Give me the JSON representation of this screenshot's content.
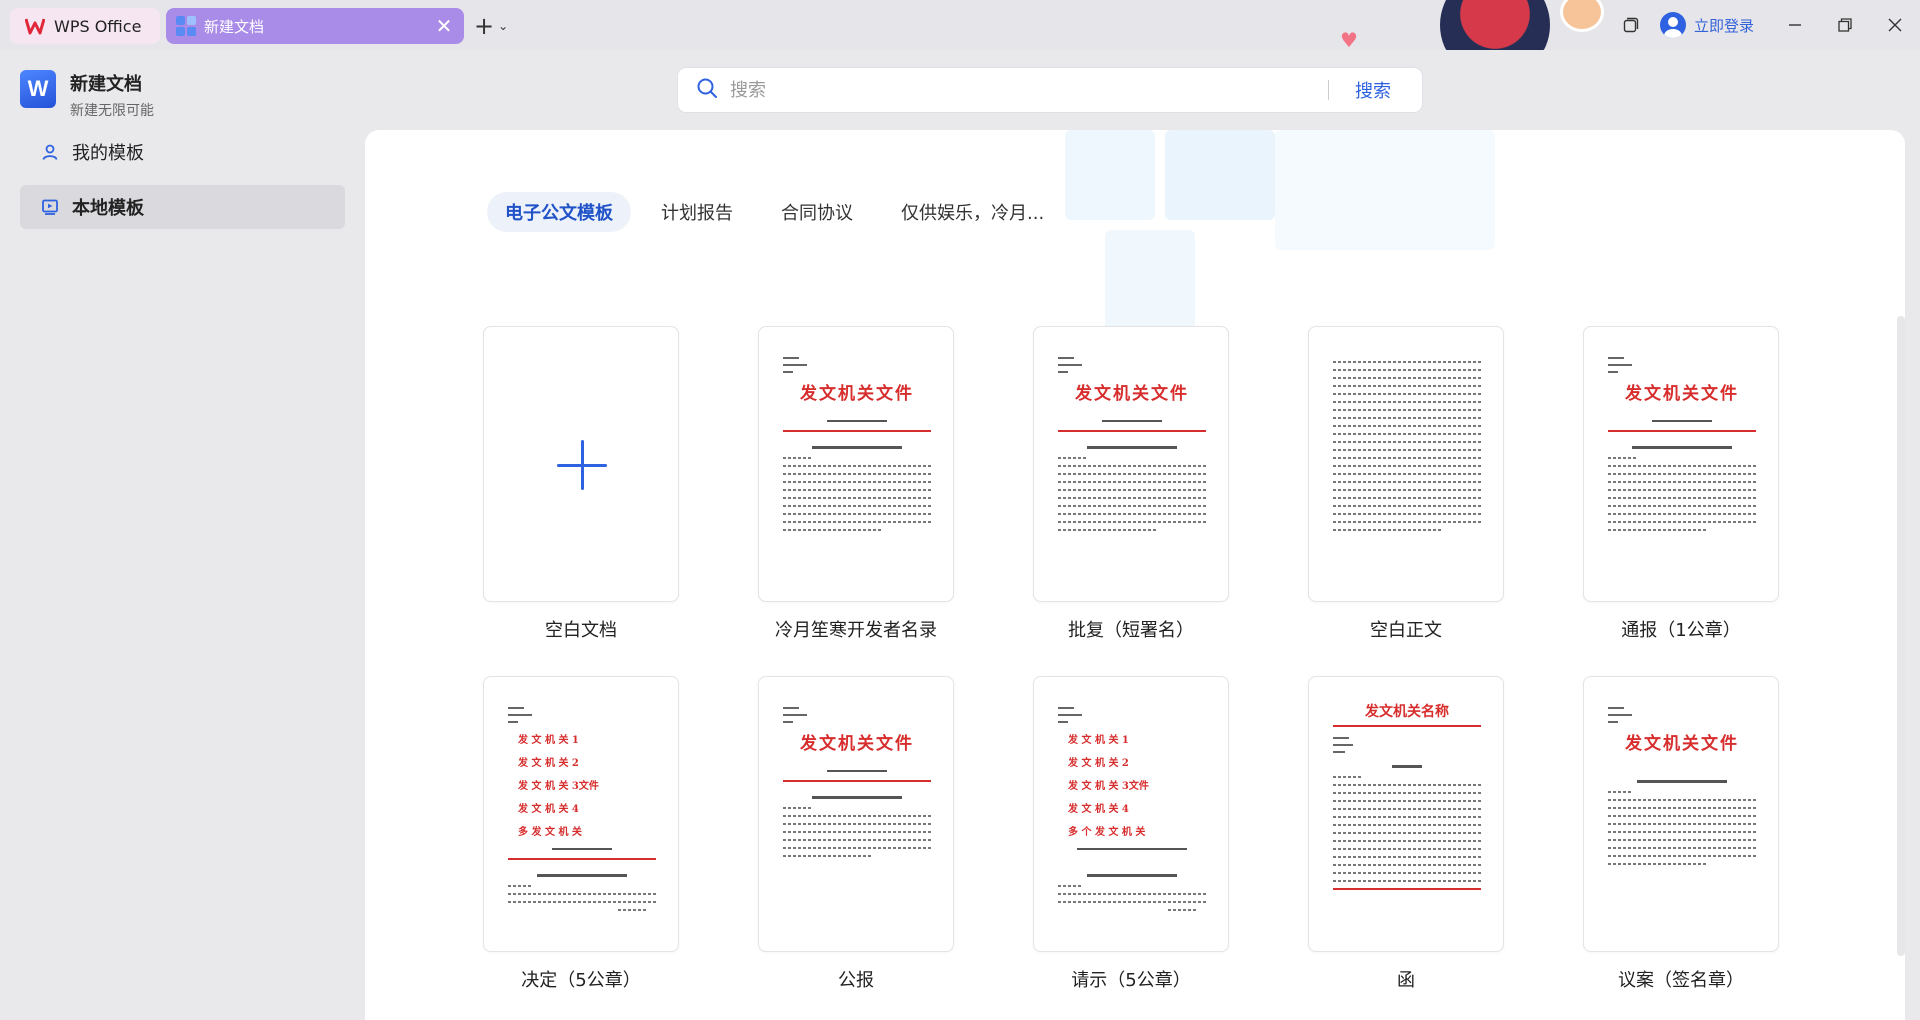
{
  "titlebar": {
    "app_tab_label": "WPS Office",
    "doc_tab_label": "新建文档",
    "close_glyph": "✕",
    "new_tab_glyph": "+",
    "login_label": "立即登录"
  },
  "sidebar": {
    "app_title": "新建文档",
    "app_subtitle": "新建无限可能",
    "app_icon_letter": "W",
    "items": [
      {
        "label": "我的模板",
        "icon": "user-icon",
        "active": false
      },
      {
        "label": "本地模板",
        "icon": "local-template-icon",
        "active": true
      }
    ]
  },
  "search": {
    "placeholder": "搜索",
    "button_label": "搜索"
  },
  "categories": [
    {
      "label": "电子公文模板",
      "active": true
    },
    {
      "label": "计划报告",
      "active": false
    },
    {
      "label": "合同协议",
      "active": false
    },
    {
      "label": "仅供娱乐，冷月...",
      "active": false
    }
  ],
  "templates": [
    {
      "name": "空白文档"
    },
    {
      "name": "冷月笙寒开发者名录",
      "thumb_title": "发文机关文件"
    },
    {
      "name": "批复（短署名）",
      "thumb_title": "发文机关文件"
    },
    {
      "name": "空白正文"
    },
    {
      "name": "通报（1公章）",
      "thumb_title": "发文机关文件"
    },
    {
      "name": "决定（5公章）",
      "thumb_rows": [
        "发 文 机 关 1",
        "发 文 机 关 2",
        "发 文 机 关 3文件",
        "发 文 机 关 4",
        "多 发 文 机 关"
      ]
    },
    {
      "name": "公报",
      "thumb_title": "发文机关文件"
    },
    {
      "name": "请示（5公章）",
      "thumb_rows": [
        "发 文 机 关 1",
        "发 文 机 关 2",
        "发 文 机 关 3文件",
        "发 文 机 关 4",
        "多 个 发 文 机 关"
      ]
    },
    {
      "name": "函",
      "thumb_title": "发文机关名称"
    },
    {
      "name": "议案（签名章）",
      "thumb_title": "发文机关文件"
    }
  ],
  "colors": {
    "accent": "#2f62e0",
    "doc_tab": "#a98be8",
    "official_red": "#d72d2d"
  }
}
